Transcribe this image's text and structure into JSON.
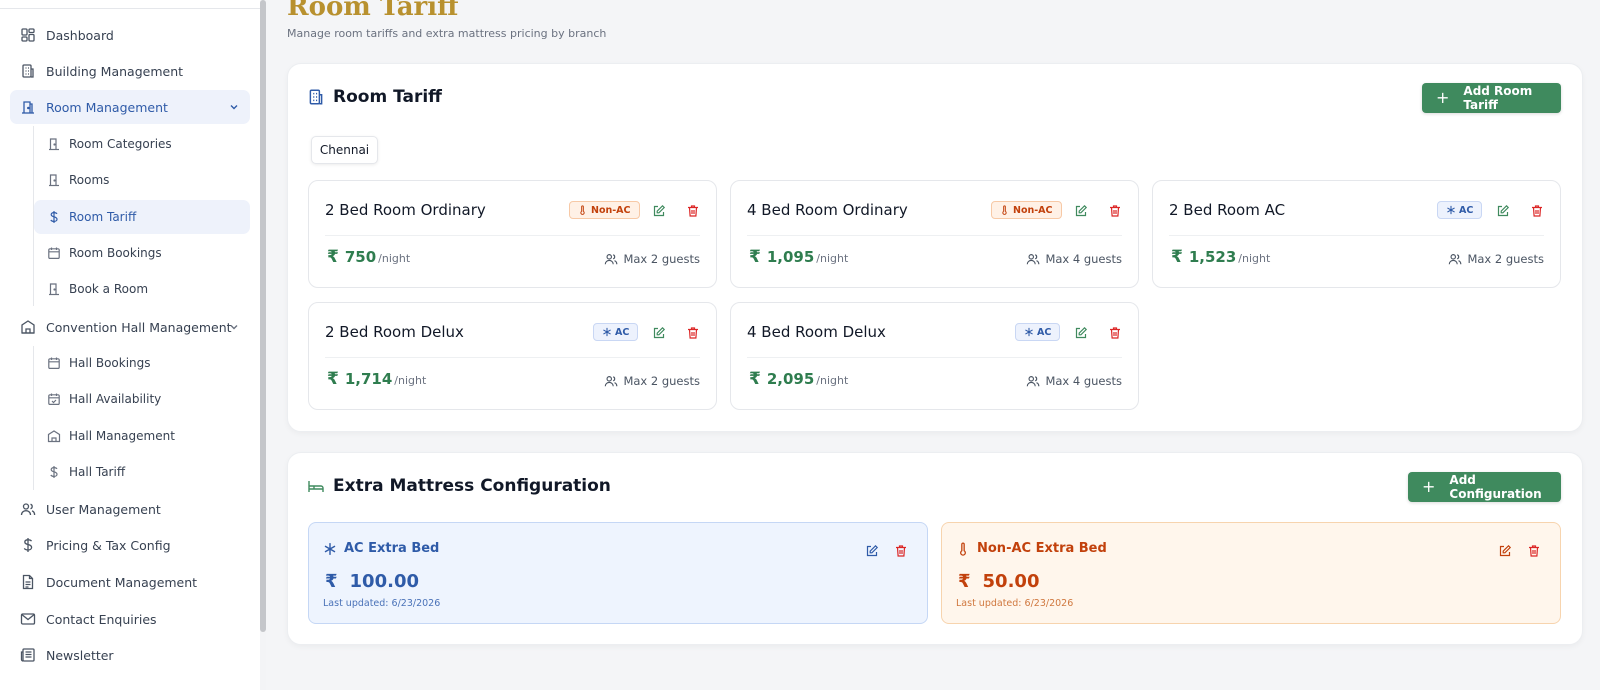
{
  "sidebar": {
    "items": [
      {
        "label": "Dashboard",
        "icon": "grid-icon"
      },
      {
        "label": "Building Management",
        "icon": "building-icon"
      },
      {
        "label": "Room Management",
        "icon": "room-icon",
        "expanded": true
      },
      {
        "label": "Room Categories",
        "icon": "door-icon"
      },
      {
        "label": "Rooms",
        "icon": "door-icon"
      },
      {
        "label": "Room Tariff",
        "icon": "dollar-icon",
        "active": true
      },
      {
        "label": "Room Bookings",
        "icon": "calendar-icon"
      },
      {
        "label": "Book a Room",
        "icon": "door-icon"
      },
      {
        "label": "Convention Hall Management",
        "icon": "hall-icon",
        "expanded": true
      },
      {
        "label": "Hall Bookings",
        "icon": "calendar-icon"
      },
      {
        "label": "Hall Availability",
        "icon": "calendar-icon"
      },
      {
        "label": "Hall Management",
        "icon": "hall-icon"
      },
      {
        "label": "Hall Tariff",
        "icon": "dollar-icon"
      },
      {
        "label": "User Management",
        "icon": "users-icon"
      },
      {
        "label": "Pricing & Tax Config",
        "icon": "dollar-icon"
      },
      {
        "label": "Document Management",
        "icon": "document-icon"
      },
      {
        "label": "Contact Enquiries",
        "icon": "mail-icon"
      },
      {
        "label": "Newsletter",
        "icon": "newspaper-icon"
      }
    ]
  },
  "header": {
    "title": "Room Tariff",
    "subtitle": "Manage room tariffs and extra mattress pricing by branch"
  },
  "room_tariff": {
    "title": "Room Tariff",
    "add_button": "Add Room Tariff",
    "branch_tab": "Chennai",
    "currency": "₹",
    "per_night": "/night",
    "rooms": [
      {
        "name": "2 Bed Room Ordinary",
        "badge": "Non-AC",
        "price": "750",
        "guests": "Max 2 guests"
      },
      {
        "name": "4 Bed Room Ordinary",
        "badge": "Non-AC",
        "price": "1,095",
        "guests": "Max 4 guests"
      },
      {
        "name": "2 Bed Room AC",
        "badge": "AC",
        "price": "1,523",
        "guests": "Max 2 guests"
      },
      {
        "name": "2 Bed Room Delux",
        "badge": "AC",
        "price": "1,714",
        "guests": "Max 2 guests"
      },
      {
        "name": "4 Bed Room Delux",
        "badge": "AC",
        "price": "2,095",
        "guests": "Max 4 guests"
      }
    ]
  },
  "mattress": {
    "title": "Extra Mattress Configuration",
    "add_button": "Add Configuration",
    "items": [
      {
        "name": "AC Extra Bed",
        "price": "100.00",
        "updated": "Last updated: 6/23/2026"
      },
      {
        "name": "Non-AC Extra Bed",
        "price": "50.00",
        "updated": "Last updated: 6/23/2026"
      }
    ]
  },
  "colors": {
    "accent_gold": "#b8912f",
    "primary_green": "#3f8a5e",
    "ac_blue": "#2f5ba8",
    "nonac_orange": "#c2410c",
    "danger_red": "#dc2626"
  }
}
